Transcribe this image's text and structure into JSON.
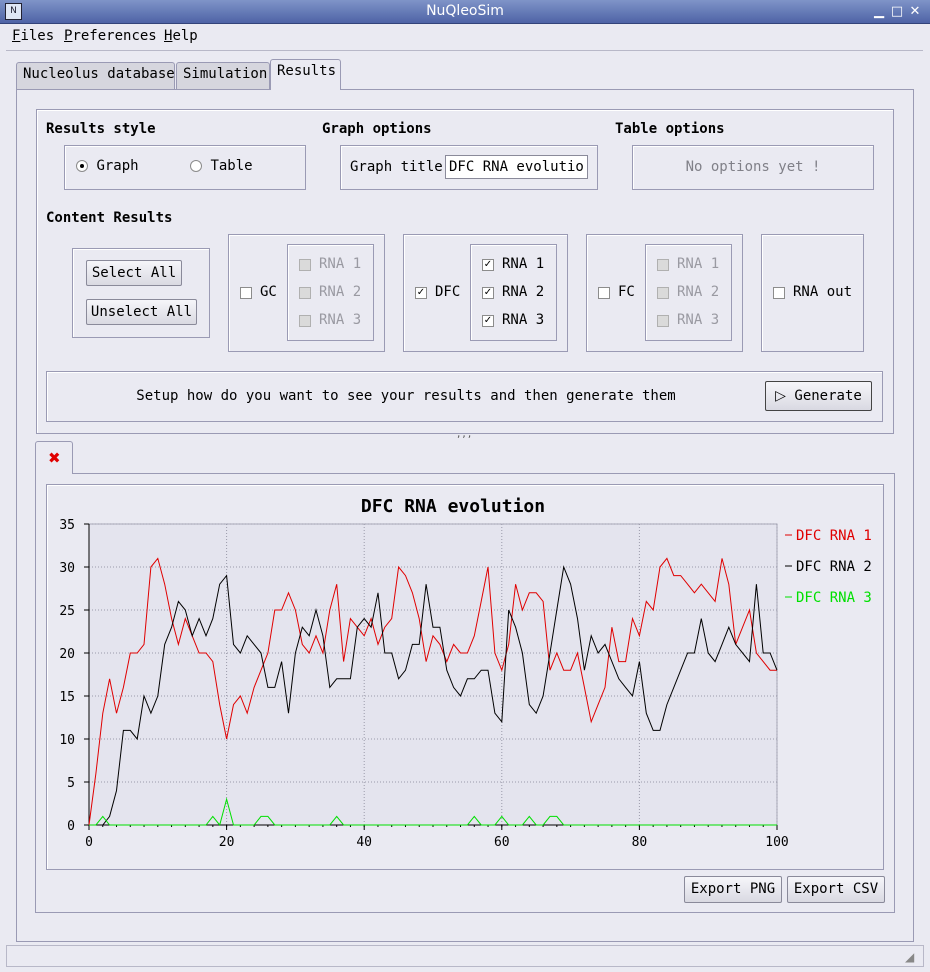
{
  "window": {
    "title": "NuQleoSim",
    "icon": "app-logo-icon",
    "controls": [
      "minimize-icon",
      "maximize-icon",
      "close-icon"
    ]
  },
  "menu": [
    {
      "label": "Files",
      "mnemonic": "F",
      "rest": "iles"
    },
    {
      "label": "Preferences",
      "mnemonic": "P",
      "rest": "references"
    },
    {
      "label": "Help",
      "mnemonic": "H",
      "rest": "elp"
    }
  ],
  "tabs": [
    {
      "label": "Nucleolus database",
      "active": false
    },
    {
      "label": "Simulation",
      "active": false
    },
    {
      "label": "Results",
      "active": true
    }
  ],
  "results_style": {
    "title": "Results style",
    "options": [
      {
        "label": "Graph",
        "selected": true
      },
      {
        "label": "Table",
        "selected": false
      }
    ]
  },
  "graph_options": {
    "title": "Graph options",
    "graph_title_label": "Graph title",
    "graph_title_value": "DFC RNA evolution"
  },
  "table_options": {
    "title": "Table options",
    "message": "No options yet !"
  },
  "content_results": {
    "title": "Content Results",
    "select_all": "Select All",
    "unselect_all": "Unselect All",
    "groups": [
      {
        "label": "GC",
        "checked": false,
        "items": [
          {
            "label": "RNA 1",
            "checked": false,
            "enabled": false
          },
          {
            "label": "RNA 2",
            "checked": false,
            "enabled": false
          },
          {
            "label": "RNA 3",
            "checked": false,
            "enabled": false
          }
        ]
      },
      {
        "label": "DFC",
        "checked": true,
        "items": [
          {
            "label": "RNA 1",
            "checked": true,
            "enabled": true
          },
          {
            "label": "RNA 2",
            "checked": true,
            "enabled": true
          },
          {
            "label": "RNA 3",
            "checked": true,
            "enabled": true
          }
        ]
      },
      {
        "label": "FC",
        "checked": false,
        "items": [
          {
            "label": "RNA 1",
            "checked": false,
            "enabled": false
          },
          {
            "label": "RNA 2",
            "checked": false,
            "enabled": false
          },
          {
            "label": "RNA 3",
            "checked": false,
            "enabled": false
          }
        ]
      }
    ],
    "rna_out": {
      "label": "RNA out",
      "checked": false
    }
  },
  "generate_bar": {
    "message": "Setup how do you want to see your results and then generate them",
    "button": "Generate",
    "icon": "play-icon"
  },
  "splitter": {
    "handle": ",,,"
  },
  "result_tab": {
    "icon": "close-tab-icon",
    "icon_color": "#e00000"
  },
  "chart_data": {
    "type": "line",
    "title": "DFC RNA evolution",
    "xlabel": "",
    "ylabel": "",
    "xlim": [
      0,
      100
    ],
    "ylim": [
      0,
      35
    ],
    "xticks": [
      0,
      20,
      40,
      60,
      80,
      100
    ],
    "yticks": [
      0,
      5,
      10,
      15,
      20,
      25,
      30,
      35
    ],
    "grid": true,
    "legend": "right",
    "x": [
      0,
      1,
      2,
      3,
      4,
      5,
      6,
      7,
      8,
      9,
      10,
      11,
      12,
      13,
      14,
      15,
      16,
      17,
      18,
      19,
      20,
      21,
      22,
      23,
      24,
      25,
      26,
      27,
      28,
      29,
      30,
      31,
      32,
      33,
      34,
      35,
      36,
      37,
      38,
      39,
      40,
      41,
      42,
      43,
      44,
      45,
      46,
      47,
      48,
      49,
      50,
      51,
      52,
      53,
      54,
      55,
      56,
      57,
      58,
      59,
      60,
      61,
      62,
      63,
      64,
      65,
      66,
      67,
      68,
      69,
      70,
      71,
      72,
      73,
      74,
      75,
      76,
      77,
      78,
      79,
      80,
      81,
      82,
      83,
      84,
      85,
      86,
      87,
      88,
      89,
      90,
      91,
      92,
      93,
      94,
      95,
      96,
      97,
      98,
      99,
      100
    ],
    "series": [
      {
        "name": "DFC RNA 1",
        "color": "#e00000",
        "values": [
          0,
          6,
          13,
          17,
          13,
          16,
          20,
          20,
          21,
          30,
          31,
          28,
          24,
          21,
          24,
          22,
          20,
          20,
          19,
          14,
          10,
          14,
          15,
          13,
          16,
          18,
          20,
          25,
          25,
          27,
          25,
          21,
          20,
          22,
          20,
          25,
          28,
          19,
          24,
          23,
          22,
          24,
          21,
          23,
          24,
          30,
          29,
          27,
          24,
          19,
          22,
          21,
          19,
          21,
          20,
          20,
          22,
          26,
          30,
          20,
          18,
          21,
          28,
          25,
          27,
          27,
          26,
          18,
          20,
          18,
          18,
          20,
          16,
          12,
          14,
          16,
          23,
          19,
          19,
          24,
          22,
          26,
          25,
          30,
          31,
          29,
          29,
          28,
          27,
          28,
          27,
          26,
          31,
          28,
          21,
          23,
          25,
          20,
          19,
          18,
          18
        ]
      },
      {
        "name": "DFC RNA 2",
        "color": "#000000",
        "values": [
          0,
          0,
          0,
          1,
          4,
          11,
          11,
          10,
          15,
          13,
          15,
          21,
          23,
          26,
          25,
          22,
          24,
          22,
          24,
          28,
          29,
          21,
          20,
          22,
          21,
          20,
          16,
          16,
          19,
          13,
          20,
          23,
          22,
          25,
          22,
          16,
          17,
          17,
          17,
          23,
          24,
          23,
          27,
          20,
          20,
          17,
          18,
          21,
          21,
          28,
          23,
          23,
          18,
          16,
          15,
          17,
          17,
          18,
          18,
          13,
          12,
          25,
          23,
          20,
          14,
          13,
          15,
          20,
          25,
          30,
          28,
          24,
          18,
          22,
          20,
          21,
          19,
          17,
          16,
          15,
          19,
          13,
          11,
          11,
          14,
          16,
          18,
          20,
          20,
          24,
          20,
          19,
          21,
          23,
          21,
          20,
          19,
          28,
          20,
          20,
          18
        ]
      },
      {
        "name": "DFC RNA 3",
        "color": "#00e000",
        "values": [
          0,
          0,
          1,
          0,
          0,
          0,
          0,
          0,
          0,
          0,
          0,
          0,
          0,
          0,
          0,
          0,
          0,
          0,
          1,
          0,
          3,
          0,
          0,
          0,
          0,
          1,
          1,
          0,
          0,
          0,
          0,
          0,
          0,
          0,
          0,
          0,
          1,
          0,
          0,
          0,
          0,
          0,
          0,
          0,
          0,
          0,
          0,
          0,
          0,
          0,
          0,
          0,
          0,
          0,
          0,
          0,
          1,
          0,
          0,
          0,
          1,
          0,
          0,
          0,
          1,
          0,
          0,
          1,
          1,
          0,
          0,
          0,
          0,
          0,
          0,
          0,
          0,
          0,
          0,
          0,
          0,
          0,
          0,
          0,
          0,
          0,
          0,
          0,
          0,
          0,
          0,
          0,
          0,
          0,
          0,
          0,
          0,
          0,
          0,
          0,
          0
        ]
      }
    ]
  },
  "export": {
    "png": "Export PNG",
    "csv": "Export CSV"
  }
}
